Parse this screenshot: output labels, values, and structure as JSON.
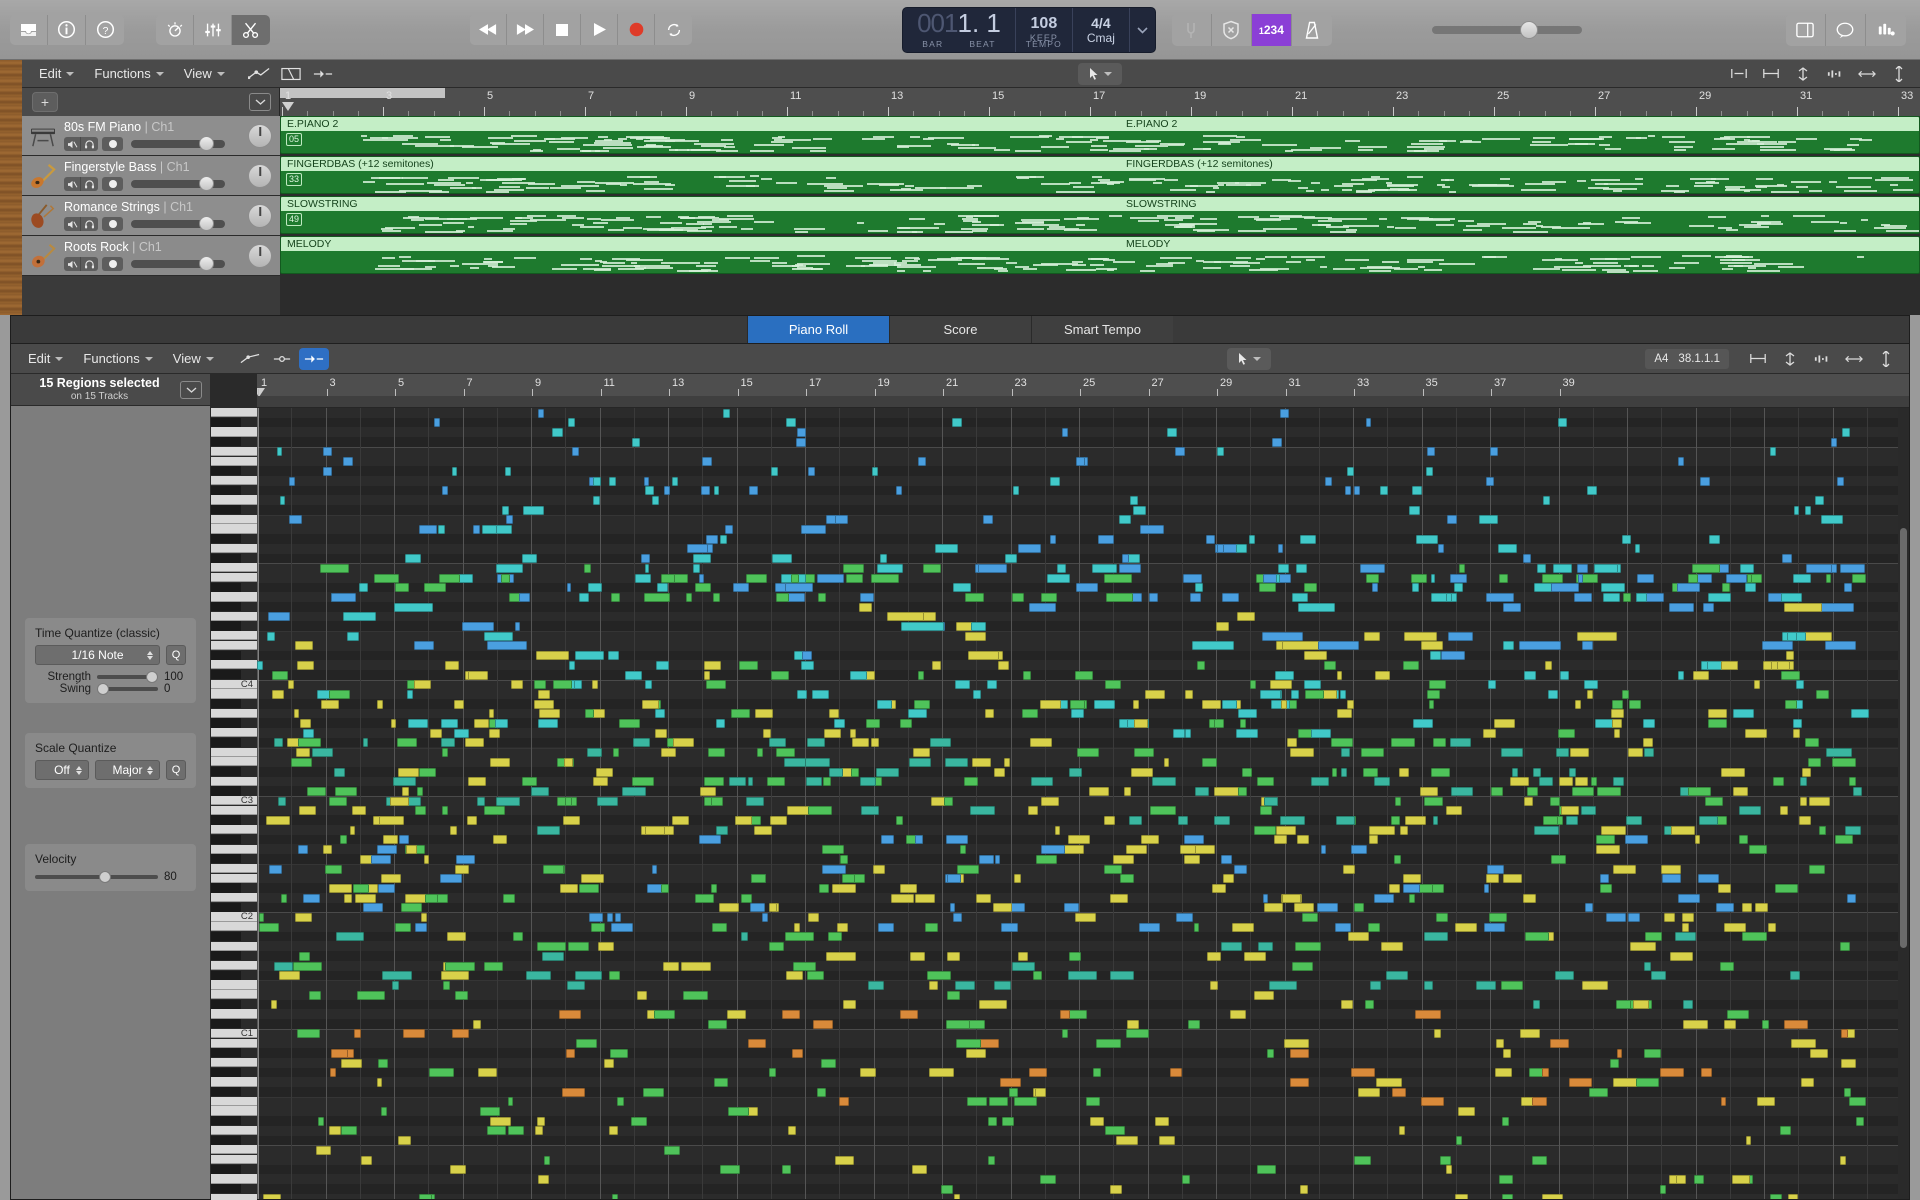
{
  "toolbar": {
    "left_buttons": [
      {
        "name": "library-icon",
        "label": "Library"
      },
      {
        "name": "info-icon",
        "label": "Info"
      },
      {
        "name": "help-icon",
        "label": "Help"
      }
    ],
    "tool_buttons": [
      {
        "name": "smart-controls-icon",
        "label": "Smart Controls"
      },
      {
        "name": "mixer-icon",
        "label": "Mixer"
      },
      {
        "name": "editors-scissors-icon",
        "label": "Editors",
        "active": true
      }
    ],
    "transport": [
      {
        "name": "rewind-button",
        "label": "Rewind"
      },
      {
        "name": "forward-button",
        "label": "Forward"
      },
      {
        "name": "stop-button",
        "label": "Stop"
      },
      {
        "name": "play-button",
        "label": "Play"
      },
      {
        "name": "record-button",
        "label": "Record"
      },
      {
        "name": "cycle-button",
        "label": "Cycle"
      }
    ],
    "right_buttons": [
      {
        "name": "tuning-fork-icon",
        "label": "Tuner"
      },
      {
        "name": "shield-x-icon",
        "label": "Low Latency Mode"
      },
      {
        "name": "count-in-icon",
        "label": "1234",
        "active": true
      },
      {
        "name": "metronome-icon",
        "label": "Metronome"
      }
    ],
    "far_right_buttons": [
      {
        "name": "list-editors-icon",
        "label": "List Editors"
      },
      {
        "name": "notes-icon",
        "label": "Notes"
      },
      {
        "name": "loop-browser-icon",
        "label": "Loop Browser"
      }
    ],
    "master_volume": 60
  },
  "lcd": {
    "position_dim": "001",
    "position_main": "1. 1",
    "position_label_bar": "BAR",
    "position_label_beat": "BEAT",
    "tempo_value": "108",
    "tempo_mode": "KEEP",
    "tempo_label": "TEMPO",
    "signature": "4/4",
    "key": "Cmaj"
  },
  "arrange": {
    "menus": [
      "Edit",
      "Functions",
      "View"
    ],
    "icon_buttons": [
      {
        "name": "automation-icon",
        "label": "Automation"
      },
      {
        "name": "flex-icon",
        "label": "Flex"
      },
      {
        "name": "snap-icon",
        "label": "Snap"
      }
    ],
    "add_track_label": "+",
    "pointer_tool": "pointer-tool",
    "ruler_bars": [
      1,
      3,
      5,
      7,
      9,
      11,
      13,
      15,
      17,
      19,
      21,
      23,
      25,
      27,
      29,
      31,
      33
    ],
    "tracks": [
      {
        "name": "80s FM Piano",
        "channel": "Ch1",
        "icon": "keyboard-icon",
        "volume": 72
      },
      {
        "name": "Fingerstyle Bass",
        "channel": "Ch1",
        "icon": "bass-guitar-icon",
        "volume": 72
      },
      {
        "name": "Romance Strings",
        "channel": "Ch1",
        "icon": "violin-icon",
        "volume": 72
      },
      {
        "name": "Roots Rock",
        "channel": "Ch1",
        "icon": "guitar-icon",
        "volume": 72
      }
    ],
    "regions": [
      {
        "name": "E.PIANO 2",
        "number": "05",
        "dup_name": "E.PIANO 2"
      },
      {
        "name": "FINGERDBAS (+12 semitones)",
        "number": "33",
        "dup_name": "FINGERDBAS (+12 semitones)"
      },
      {
        "name": "SLOWSTRING",
        "number": "49",
        "dup_name": "SLOWSTRING"
      },
      {
        "name": "MELODY",
        "number": "",
        "dup_name": "MELODY"
      }
    ]
  },
  "editor": {
    "tabs": [
      {
        "label": "Piano Roll",
        "active": true
      },
      {
        "label": "Score",
        "active": false
      },
      {
        "label": "Smart Tempo",
        "active": false
      }
    ],
    "menus": [
      "Edit",
      "Functions",
      "View"
    ],
    "icon_buttons": [
      {
        "name": "velocity-icon",
        "label": "Velocity"
      },
      {
        "name": "brush-icon",
        "label": "Brush"
      },
      {
        "name": "snap-icon",
        "label": "Snap",
        "active": true
      }
    ],
    "position_note": "A4",
    "position_value": "38.1.1.1",
    "selection_title": "15 Regions selected",
    "selection_subtitle": "on 15 Tracks",
    "time_quantize": {
      "label": "Time Quantize (classic)",
      "value": "1/16 Note",
      "q_button": "Q",
      "strength_label": "Strength",
      "strength_value": "100",
      "swing_label": "Swing",
      "swing_value": "0"
    },
    "scale_quantize": {
      "label": "Scale Quantize",
      "mode": "Off",
      "scale": "Major",
      "q_button": "Q"
    },
    "velocity": {
      "label": "Velocity",
      "value": "80"
    },
    "ruler_bars": [
      1,
      3,
      5,
      7,
      9,
      11,
      13,
      15,
      17,
      19,
      21,
      23,
      25,
      27,
      29,
      31,
      33,
      35,
      37,
      39
    ],
    "octave_labels": [
      "C4",
      "C3",
      "C2",
      "C1"
    ],
    "note_colors": {
      "blue": "#4a9fe0",
      "cyan": "#41c9c9",
      "green": "#4fc35a",
      "yellow": "#d8d14a",
      "orange": "#d98a3a",
      "teal": "#3ab6a0"
    }
  }
}
